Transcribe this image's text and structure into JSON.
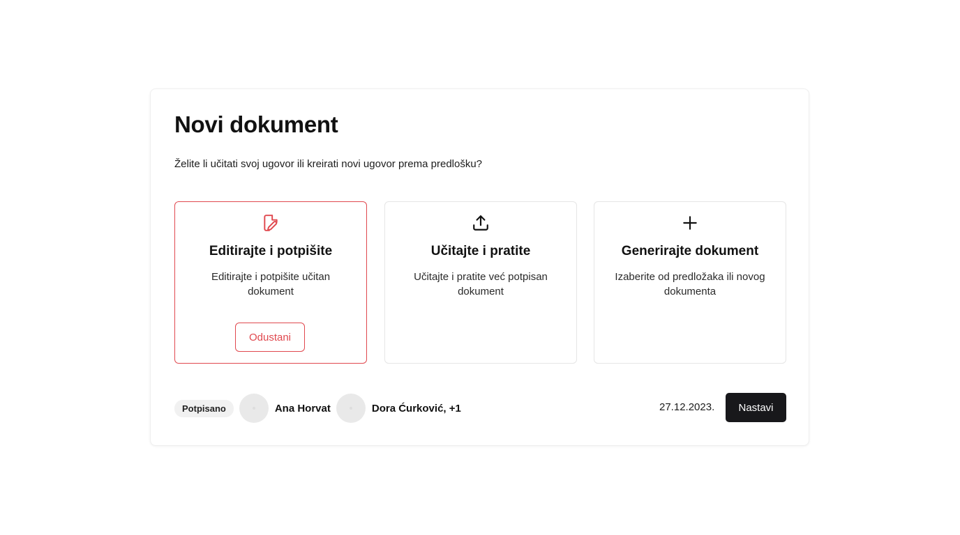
{
  "dialog": {
    "title": "Novi dokument",
    "subtitle": "Želite li učitati svoj ugovor ili kreirati novi ugovor prema predlošku?"
  },
  "options": [
    {
      "icon": "file-signature-icon",
      "title": "Editirajte i potpišite",
      "description": "Editirajte i potpišite učitan dokument",
      "selected": true,
      "cancel_label": "Odustani"
    },
    {
      "icon": "upload-icon",
      "title": "Učitajte i pratite",
      "description": "Učitajte i pratite već potpisan dokument",
      "selected": false
    },
    {
      "icon": "plus-icon",
      "title": "Generirajte dokument",
      "description": "Izaberite od predložaka ili novog dokumenta",
      "selected": false
    }
  ],
  "footer": {
    "status": "Potpisano",
    "signers": [
      {
        "name": "Ana Horvat"
      },
      {
        "name": "Dora Ćurković, +1"
      }
    ],
    "date": "27.12.2023.",
    "continue_label": "Nastavi"
  },
  "colors": {
    "accent": "#e0484e",
    "primary_button": "#18181b",
    "badge_bg": "#f1f1f1",
    "avatar_bg": "#e9e9e9"
  }
}
